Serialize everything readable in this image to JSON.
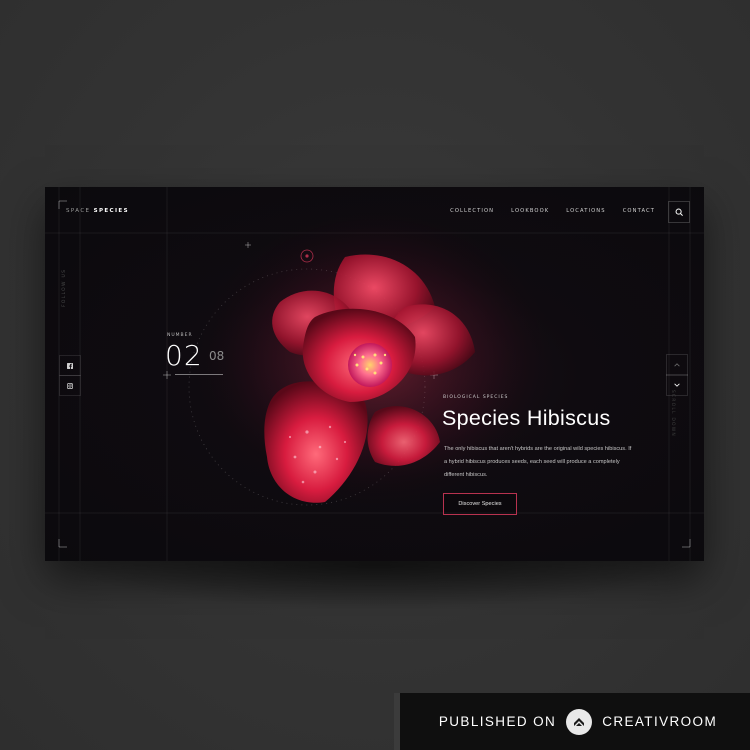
{
  "brand": {
    "prefix": "SPACE",
    "name": "SPECIES"
  },
  "nav": {
    "items": [
      "COLLECTION",
      "LOOKBOOK",
      "LOCATIONS",
      "CONTACT"
    ]
  },
  "left_rail": {
    "vertical_text": "FOLLOW US"
  },
  "right_rail": {
    "vertical_text": "SCROLL DOWN"
  },
  "slider": {
    "label": "NUMBER",
    "current": "02",
    "total": "08"
  },
  "hero": {
    "kicker": "BIOLOGICAL SPECIES",
    "title": "Species Hibiscus",
    "description": "The only hibiscus that aren't hybrids are the original wild species hibiscus. If a hybrid hibiscus produces seeds, each seed will produce a completely different hibiscus.",
    "cta_label": "Discover Species"
  },
  "badge": {
    "published_on": "PUBLISHED ON",
    "site": "CREATIVROOM"
  },
  "colors": {
    "background": "#343434",
    "card": "#0b0a0d",
    "accent": "#b8324f",
    "flower": "#e0254a"
  },
  "icons": [
    "search-icon",
    "facebook-icon",
    "instagram-icon",
    "chevron-up-icon",
    "chevron-down-icon",
    "creativroom-logo-icon"
  ]
}
